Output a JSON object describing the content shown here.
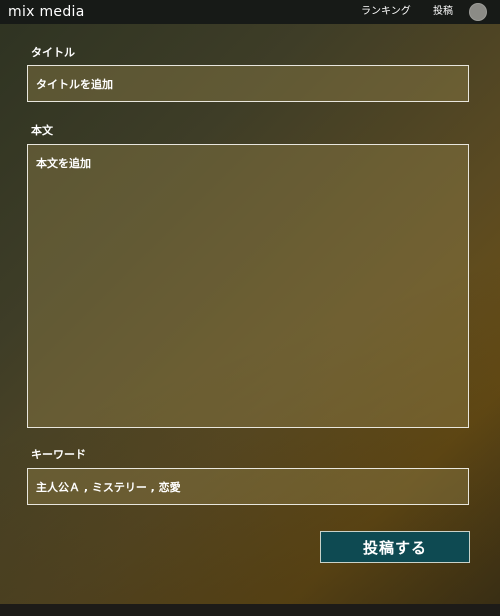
{
  "header": {
    "brand": "mix media",
    "nav": {
      "ranking": "ランキング",
      "post": "投稿"
    },
    "avatar_color": "#8b8b86"
  },
  "form": {
    "title": {
      "label": "タイトル",
      "value": "タイトルを追加"
    },
    "body": {
      "label": "本文",
      "value": "本文を追加"
    },
    "keyword": {
      "label": "キーワード",
      "value": "主人公Ａ , ミステリー , 恋愛"
    },
    "submit_label": "投稿する"
  },
  "colors": {
    "header_bg": "#171a17",
    "submit_bg": "#0e4a52",
    "field_border": "#e8e6dd",
    "background_accent": "#6b4f14"
  }
}
